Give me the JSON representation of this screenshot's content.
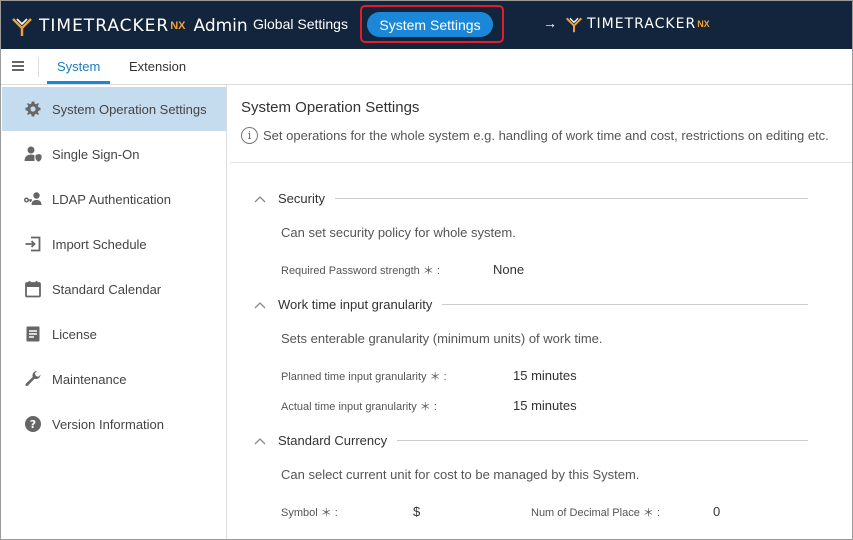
{
  "header": {
    "logo_text": "TIMETRACKER",
    "logo_nx": "NX",
    "logo_admin": "Admin",
    "global_settings": "Global Settings",
    "system_settings": "System Settings",
    "arrow": "→",
    "link_logo_text": "TIMETRACKER",
    "link_logo_nx": "NX",
    "accent_color": "#f0a23a",
    "highlight_color": "#e11d2a"
  },
  "subnav": {
    "tabs": [
      "System",
      "Extension"
    ]
  },
  "sidebar": {
    "items": [
      {
        "label": "System Operation Settings",
        "icon": "gear-icon"
      },
      {
        "label": "Single Sign-On",
        "icon": "user-shield-icon"
      },
      {
        "label": "LDAP Authentication",
        "icon": "user-key-icon"
      },
      {
        "label": "Import Schedule",
        "icon": "import-icon"
      },
      {
        "label": "Standard Calendar",
        "icon": "calendar-icon"
      },
      {
        "label": "License",
        "icon": "document-icon"
      },
      {
        "label": "Maintenance",
        "icon": "wrench-icon"
      },
      {
        "label": "Version Information",
        "icon": "help-icon"
      }
    ]
  },
  "main": {
    "title": "System Operation Settings",
    "info": "Set operations for the whole system e.g. handling of work time and cost, restrictions on editing etc.",
    "sections": [
      {
        "title": "Security",
        "desc": "Can set security policy for whole system.",
        "fields": [
          {
            "label": "Required Password strength ＊ :",
            "value": "None"
          }
        ]
      },
      {
        "title": "Work time input granularity",
        "desc": "Sets enterable granularity (minimum units) of work time.",
        "fields": [
          {
            "label": "Planned time input granularity ＊ :",
            "value": "15 minutes"
          },
          {
            "label": "Actual time input granularity ＊ :",
            "value": "15 minutes"
          }
        ]
      },
      {
        "title": "Standard Currency",
        "desc": "Can select current unit for cost to be managed by this System.",
        "fields": [
          {
            "label": "Symbol ＊ :",
            "value": "$"
          },
          {
            "label": "Num of Decimal Place ＊ :",
            "value": "0"
          }
        ]
      }
    ]
  }
}
